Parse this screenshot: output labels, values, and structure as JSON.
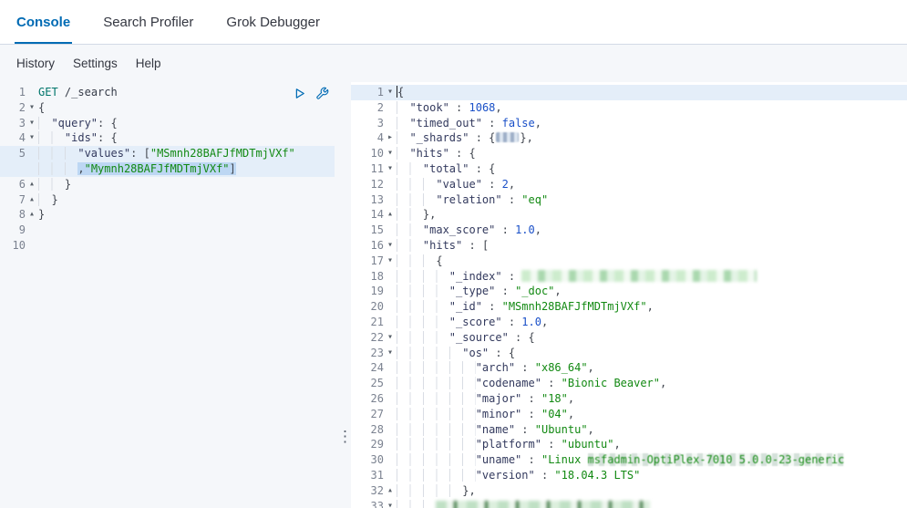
{
  "tabs": {
    "console": "Console",
    "search_profiler": "Search Profiler",
    "grok_debugger": "Grok Debugger"
  },
  "menu": {
    "history": "History",
    "settings": "Settings",
    "help": "Help"
  },
  "colors": {
    "accent": "#006bb4",
    "tab_inactive": "#343741",
    "string_green": "#128912",
    "number_blue": "#1a50c8",
    "key_navy": "#333a5e"
  },
  "icons": {
    "fold_down": "▾",
    "fold_right": "▸",
    "fold_up": "▴",
    "drag_handle": "⋮",
    "send_request": "play-triangle",
    "request_options": "wrench"
  },
  "request_editor": {
    "lines": [
      {
        "num": "1",
        "fold": "",
        "tokens": [
          {
            "c": "method",
            "t": "GET"
          },
          {
            "c": "punc",
            "t": " "
          },
          {
            "c": "url",
            "t": "/_search"
          }
        ]
      },
      {
        "num": "2",
        "fold": "down",
        "tokens": [
          {
            "c": "punc",
            "t": "{"
          }
        ]
      },
      {
        "num": "3",
        "fold": "down",
        "tokens": [
          {
            "c": "ind",
            "t": "  "
          },
          {
            "c": "key",
            "t": "\"query\""
          },
          {
            "c": "punc",
            "t": ": {"
          }
        ]
      },
      {
        "num": "4",
        "fold": "down",
        "tokens": [
          {
            "c": "ind",
            "t": "    "
          },
          {
            "c": "key",
            "t": "\"ids\""
          },
          {
            "c": "punc",
            "t": ": {"
          }
        ]
      },
      {
        "num": "5",
        "fold": "",
        "hl": "row",
        "tokens": [
          {
            "c": "ind",
            "t": "      "
          },
          {
            "c": "key",
            "t": "\"values\""
          },
          {
            "c": "punc",
            "t": ": ["
          },
          {
            "c": "str",
            "t": "\"MSmnh28BAFJfMDTmjVXf\""
          }
        ]
      },
      {
        "num": "",
        "fold": "",
        "hl": "row",
        "tokens": [
          {
            "c": "ind",
            "t": "      "
          },
          {
            "c": "punc sel",
            "t": ","
          },
          {
            "c": "str sel",
            "t": "\"Mymnh28BAFJfMDTmjVXf\""
          },
          {
            "c": "punc sel",
            "t": "]"
          }
        ]
      },
      {
        "num": "6",
        "fold": "up",
        "tokens": [
          {
            "c": "ind",
            "t": "    "
          },
          {
            "c": "punc",
            "t": "}"
          }
        ]
      },
      {
        "num": "7",
        "fold": "up",
        "tokens": [
          {
            "c": "ind",
            "t": "  "
          },
          {
            "c": "punc",
            "t": "}"
          }
        ]
      },
      {
        "num": "8",
        "fold": "up",
        "tokens": [
          {
            "c": "punc",
            "t": "}"
          }
        ]
      },
      {
        "num": "9",
        "fold": "",
        "tokens": []
      },
      {
        "num": "10",
        "fold": "",
        "tokens": []
      }
    ]
  },
  "response_editor": {
    "lines": [
      {
        "num": "1",
        "fold": "down",
        "hl": "row",
        "tokens": [
          {
            "c": "caret",
            "t": ""
          },
          {
            "c": "punc",
            "t": "{"
          }
        ]
      },
      {
        "num": "2",
        "fold": "",
        "tokens": [
          {
            "c": "ind",
            "t": "  "
          },
          {
            "c": "key",
            "t": "\"took\""
          },
          {
            "c": "punc",
            "t": " : "
          },
          {
            "c": "num",
            "t": "1068"
          },
          {
            "c": "punc",
            "t": ","
          }
        ]
      },
      {
        "num": "3",
        "fold": "",
        "tokens": [
          {
            "c": "ind",
            "t": "  "
          },
          {
            "c": "key",
            "t": "\"timed_out\""
          },
          {
            "c": "punc",
            "t": " : "
          },
          {
            "c": "bool",
            "t": "false"
          },
          {
            "c": "punc",
            "t": ","
          }
        ]
      },
      {
        "num": "4",
        "fold": "right",
        "tokens": [
          {
            "c": "ind",
            "t": "  "
          },
          {
            "c": "key",
            "t": "\"_shards\""
          },
          {
            "c": "punc",
            "t": " : {"
          },
          {
            "c": "badge",
            "t": ""
          },
          {
            "c": "punc",
            "t": "},"
          }
        ]
      },
      {
        "num": "10",
        "fold": "down",
        "tokens": [
          {
            "c": "ind",
            "t": "  "
          },
          {
            "c": "key",
            "t": "\"hits\""
          },
          {
            "c": "punc",
            "t": " : {"
          }
        ]
      },
      {
        "num": "11",
        "fold": "down",
        "tokens": [
          {
            "c": "ind",
            "t": "    "
          },
          {
            "c": "key",
            "t": "\"total\""
          },
          {
            "c": "punc",
            "t": " : {"
          }
        ]
      },
      {
        "num": "12",
        "fold": "",
        "tokens": [
          {
            "c": "ind",
            "t": "      "
          },
          {
            "c": "key",
            "t": "\"value\""
          },
          {
            "c": "punc",
            "t": " : "
          },
          {
            "c": "num",
            "t": "2"
          },
          {
            "c": "punc",
            "t": ","
          }
        ]
      },
      {
        "num": "13",
        "fold": "",
        "tokens": [
          {
            "c": "ind",
            "t": "      "
          },
          {
            "c": "key",
            "t": "\"relation\""
          },
          {
            "c": "punc",
            "t": " : "
          },
          {
            "c": "str",
            "t": "\"eq\""
          }
        ]
      },
      {
        "num": "14",
        "fold": "up",
        "tokens": [
          {
            "c": "ind",
            "t": "    "
          },
          {
            "c": "punc",
            "t": "},"
          }
        ]
      },
      {
        "num": "15",
        "fold": "",
        "tokens": [
          {
            "c": "ind",
            "t": "    "
          },
          {
            "c": "key",
            "t": "\"max_score\""
          },
          {
            "c": "punc",
            "t": " : "
          },
          {
            "c": "num",
            "t": "1.0"
          },
          {
            "c": "punc",
            "t": ","
          }
        ]
      },
      {
        "num": "16",
        "fold": "down",
        "tokens": [
          {
            "c": "ind",
            "t": "    "
          },
          {
            "c": "key",
            "t": "\"hits\""
          },
          {
            "c": "punc",
            "t": " : ["
          }
        ]
      },
      {
        "num": "17",
        "fold": "down",
        "tokens": [
          {
            "c": "ind",
            "t": "      "
          },
          {
            "c": "punc",
            "t": "{"
          }
        ]
      },
      {
        "num": "18",
        "fold": "",
        "tokens": [
          {
            "c": "ind",
            "t": "        "
          },
          {
            "c": "key",
            "t": "\"_index\""
          },
          {
            "c": "punc",
            "t": " : "
          },
          {
            "c": "blurindex",
            "t": ""
          }
        ]
      },
      {
        "num": "19",
        "fold": "",
        "tokens": [
          {
            "c": "ind",
            "t": "        "
          },
          {
            "c": "key",
            "t": "\"_type\""
          },
          {
            "c": "punc",
            "t": " : "
          },
          {
            "c": "str",
            "t": "\"_doc\""
          },
          {
            "c": "punc",
            "t": ","
          }
        ]
      },
      {
        "num": "20",
        "fold": "",
        "tokens": [
          {
            "c": "ind",
            "t": "        "
          },
          {
            "c": "key",
            "t": "\"_id\""
          },
          {
            "c": "punc",
            "t": " : "
          },
          {
            "c": "str",
            "t": "\"MSmnh28BAFJfMDTmjVXf\""
          },
          {
            "c": "punc",
            "t": ","
          }
        ]
      },
      {
        "num": "21",
        "fold": "",
        "tokens": [
          {
            "c": "ind",
            "t": "        "
          },
          {
            "c": "key",
            "t": "\"_score\""
          },
          {
            "c": "punc",
            "t": " : "
          },
          {
            "c": "num",
            "t": "1.0"
          },
          {
            "c": "punc",
            "t": ","
          }
        ]
      },
      {
        "num": "22",
        "fold": "down",
        "tokens": [
          {
            "c": "ind",
            "t": "        "
          },
          {
            "c": "key",
            "t": "\"_source\""
          },
          {
            "c": "punc",
            "t": " : {"
          }
        ]
      },
      {
        "num": "23",
        "fold": "down",
        "tokens": [
          {
            "c": "ind",
            "t": "          "
          },
          {
            "c": "key",
            "t": "\"os\""
          },
          {
            "c": "punc",
            "t": " : {"
          }
        ]
      },
      {
        "num": "24",
        "fold": "",
        "tokens": [
          {
            "c": "ind",
            "t": "            "
          },
          {
            "c": "key",
            "t": "\"arch\""
          },
          {
            "c": "punc",
            "t": " : "
          },
          {
            "c": "str",
            "t": "\"x86_64\""
          },
          {
            "c": "punc",
            "t": ","
          }
        ]
      },
      {
        "num": "25",
        "fold": "",
        "tokens": [
          {
            "c": "ind",
            "t": "            "
          },
          {
            "c": "key",
            "t": "\"codename\""
          },
          {
            "c": "punc",
            "t": " : "
          },
          {
            "c": "str",
            "t": "\"Bionic Beaver\""
          },
          {
            "c": "punc",
            "t": ","
          }
        ]
      },
      {
        "num": "26",
        "fold": "",
        "tokens": [
          {
            "c": "ind",
            "t": "            "
          },
          {
            "c": "key",
            "t": "\"major\""
          },
          {
            "c": "punc",
            "t": " : "
          },
          {
            "c": "str",
            "t": "\"18\""
          },
          {
            "c": "punc",
            "t": ","
          }
        ]
      },
      {
        "num": "27",
        "fold": "",
        "tokens": [
          {
            "c": "ind",
            "t": "            "
          },
          {
            "c": "key",
            "t": "\"minor\""
          },
          {
            "c": "punc",
            "t": " : "
          },
          {
            "c": "str",
            "t": "\"04\""
          },
          {
            "c": "punc",
            "t": ","
          }
        ]
      },
      {
        "num": "28",
        "fold": "",
        "tokens": [
          {
            "c": "ind",
            "t": "            "
          },
          {
            "c": "key",
            "t": "\"name\""
          },
          {
            "c": "punc",
            "t": " : "
          },
          {
            "c": "str",
            "t": "\"Ubuntu\""
          },
          {
            "c": "punc",
            "t": ","
          }
        ]
      },
      {
        "num": "29",
        "fold": "",
        "tokens": [
          {
            "c": "ind",
            "t": "            "
          },
          {
            "c": "key",
            "t": "\"platform\""
          },
          {
            "c": "punc",
            "t": " : "
          },
          {
            "c": "str",
            "t": "\"ubuntu\""
          },
          {
            "c": "punc",
            "t": ","
          }
        ]
      },
      {
        "num": "30",
        "fold": "",
        "tokens": [
          {
            "c": "ind",
            "t": "            "
          },
          {
            "c": "key",
            "t": "\"uname\""
          },
          {
            "c": "punc",
            "t": " : "
          },
          {
            "c": "str",
            "t": "\"Linux "
          },
          {
            "c": "str redact",
            "t": "msfadmin-OptiPlex-7010 "
          },
          {
            "c": "str redact",
            "t": "5.0.0-23-generic"
          }
        ]
      },
      {
        "num": "31",
        "fold": "",
        "tokens": [
          {
            "c": "ind",
            "t": "            "
          },
          {
            "c": "key",
            "t": "\"version\""
          },
          {
            "c": "punc",
            "t": " : "
          },
          {
            "c": "str",
            "t": "\"18.04.3 LTS\""
          }
        ]
      },
      {
        "num": "32",
        "fold": "up",
        "tokens": [
          {
            "c": "ind",
            "t": "          "
          },
          {
            "c": "punc",
            "t": "},"
          }
        ]
      },
      {
        "num": "33",
        "fold": "down",
        "tokens": [
          {
            "c": "ind",
            "t": "      "
          },
          {
            "c": "blurbottom",
            "t": ""
          }
        ]
      }
    ]
  }
}
